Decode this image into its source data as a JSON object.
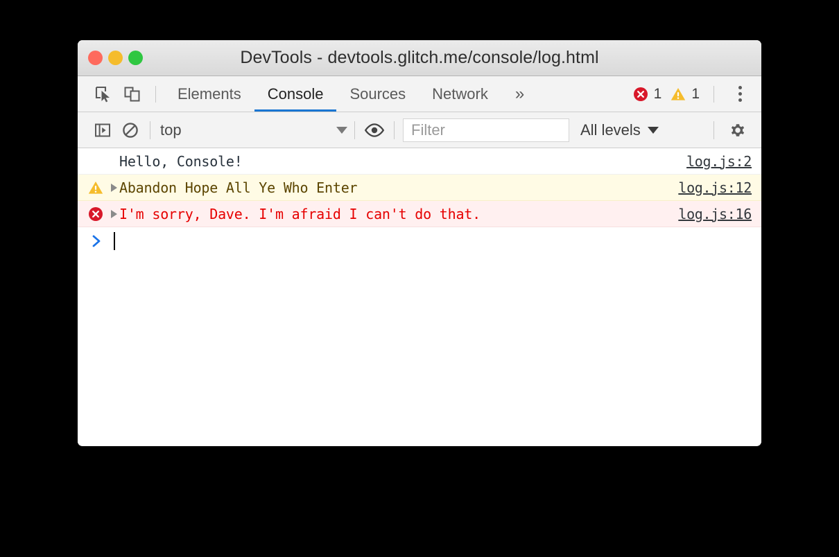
{
  "window": {
    "title": "DevTools - devtools.glitch.me/console/log.html",
    "traffic_lights": [
      {
        "name": "close",
        "color": "#fe6a5d"
      },
      {
        "name": "minimize",
        "color": "#f5bc2c"
      },
      {
        "name": "maximize",
        "color": "#2fc741"
      }
    ]
  },
  "tabbar": {
    "left_icons": [
      {
        "name": "inspect-element-icon"
      },
      {
        "name": "device-toolbar-icon"
      }
    ],
    "tabs": [
      {
        "label": "Elements",
        "active": false
      },
      {
        "label": "Console",
        "active": true
      },
      {
        "label": "Sources",
        "active": false
      },
      {
        "label": "Network",
        "active": false
      }
    ],
    "more_label": "»",
    "error_count": "1",
    "warning_count": "1",
    "menu_name": "main-menu-icon",
    "active_tab_underline_color": "#1976d2"
  },
  "console_toolbar": {
    "sidebar_toggle_name": "console-sidebar-toggle-icon",
    "clear_name": "clear-console-icon",
    "context": {
      "value": "top"
    },
    "eye_name": "live-expression-icon",
    "filter": {
      "placeholder": "Filter",
      "value": ""
    },
    "levels": {
      "value": "All levels"
    },
    "settings_name": "settings-gear-icon"
  },
  "console": {
    "messages": [
      {
        "level": "log",
        "text": "Hello, Console!",
        "source": "log.js:2",
        "has_disclosure": false,
        "icon": null
      },
      {
        "level": "warn",
        "text": "Abandon Hope All Ye Who Enter",
        "source": "log.js:12",
        "has_disclosure": true,
        "icon": "warning-triangle-icon"
      },
      {
        "level": "error",
        "text": "I'm sorry, Dave. I'm afraid I can't do that.",
        "source": "log.js:16",
        "has_disclosure": true,
        "icon": "error-circle-icon"
      }
    ],
    "prompt": {
      "chevron": "›",
      "input_value": ""
    }
  },
  "colors": {
    "warning_bg": "#fffbe5",
    "warning_text": "#5c4500",
    "error_bg": "#fff0f0",
    "error_text": "#e60000",
    "accent": "#1976d2",
    "prompt_chevron": "#1a73e8"
  }
}
